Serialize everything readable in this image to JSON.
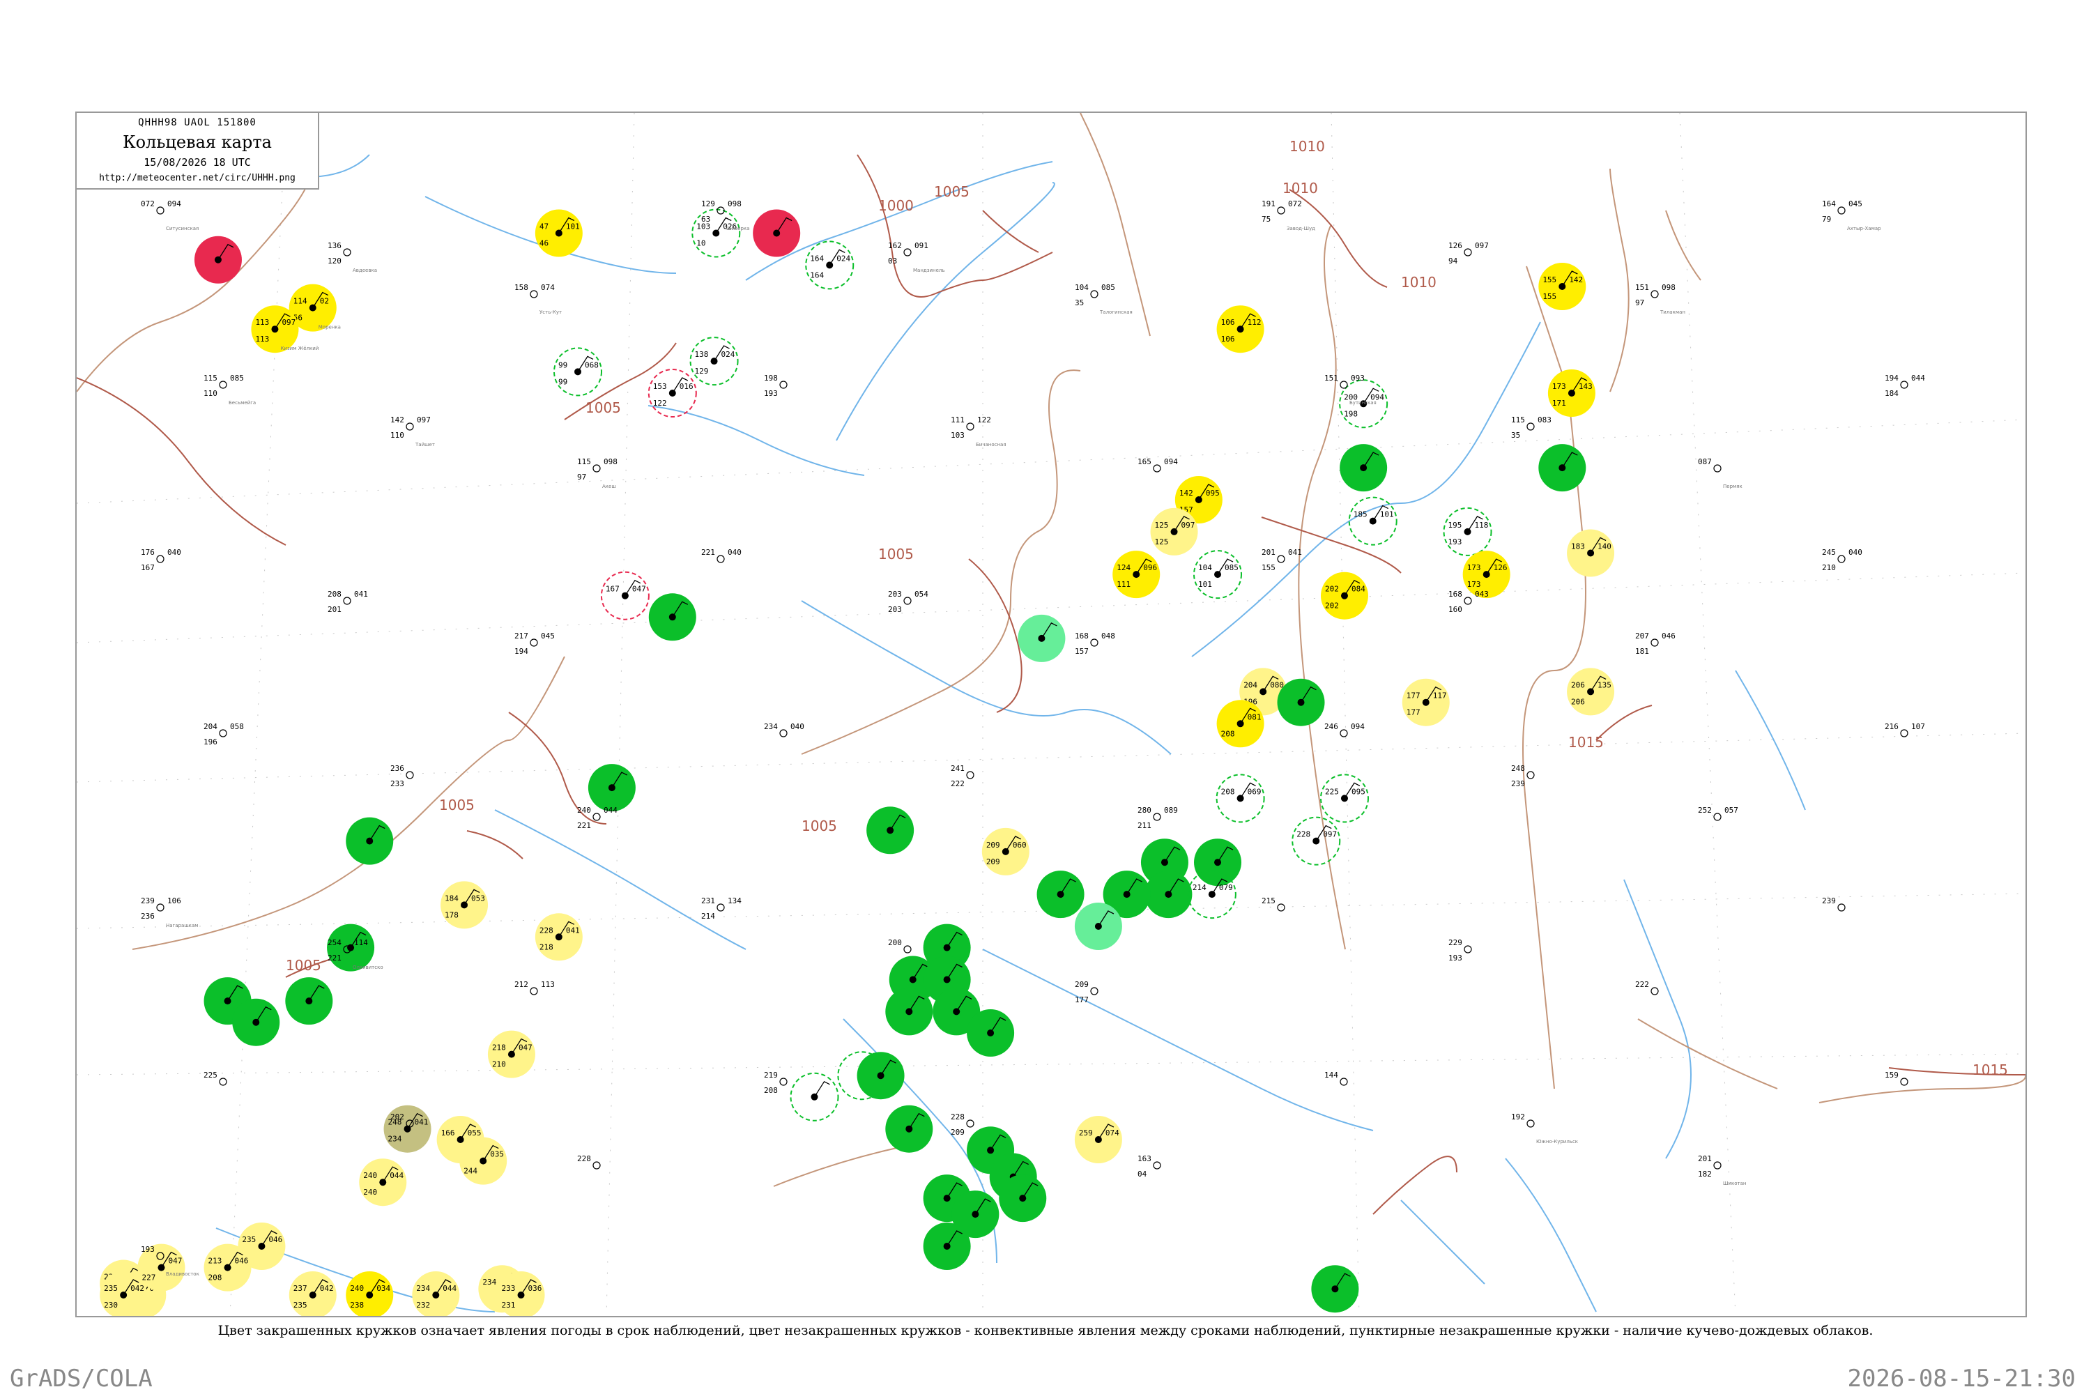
{
  "title": {
    "code": "QHHH98  UAOL  151800",
    "main": "Кольцевая карта",
    "date": "15/08/2026 18 UTC",
    "url": "http://meteocenter.net/circ/UHHH.png"
  },
  "caption": "Цвет закрашенных кружков означает явления погоды в срок наблюдений, цвет незакрашенных кружков - конвективные явления между сроками наблюдений, пунктирные незакрашенные кружки - наличие кучево-дождевых облаков.",
  "footer": {
    "left": "GrADS/COLA",
    "right": "2026-08-15-21:30"
  },
  "colors": {
    "rain": "#0bbf2a",
    "drizzle": "#66ee99",
    "haze": "#ffee00",
    "light_haze": "#fff48a",
    "thunder": "#e8294f",
    "dust": "#c4c081",
    "isobar": "#b05a4a",
    "river": "#58a8e6",
    "border": "#c4967a"
  },
  "isobars": [
    {
      "label": "1000"
    },
    {
      "label": "1005"
    },
    {
      "label": "1005"
    },
    {
      "label": "1005"
    },
    {
      "label": "1005"
    },
    {
      "label": "1005"
    },
    {
      "label": "1010"
    },
    {
      "label": "1010"
    },
    {
      "label": "1010"
    },
    {
      "label": "1010"
    },
    {
      "label": "1015"
    },
    {
      "label": "1015"
    },
    {
      "label": "1005"
    }
  ],
  "stations": [
    {
      "type": "thunder",
      "name": "",
      "t": "",
      "p": "",
      "d": "",
      "lat": 0.925,
      "lon": 0.06
    },
    {
      "type": "haze",
      "name": "Моренка",
      "t": "114",
      "p": "56",
      "d": "02",
      "lat": 0.88,
      "lon": 0.11
    },
    {
      "type": "haze",
      "name": "Кизим Жёлкий",
      "t": "113",
      "p": "113",
      "d": "097",
      "lat": 0.86,
      "lon": 0.09
    },
    {
      "type": "haze",
      "name": "",
      "t": "47",
      "p": "46",
      "d": "101",
      "lat": 0.95,
      "lon": 0.24
    },
    {
      "type": "thunder",
      "name": "",
      "t": "",
      "p": "",
      "d": "",
      "lat": 0.95,
      "lon": 0.355
    },
    {
      "type": "ring_red",
      "name": "",
      "t": "153",
      "p": "122",
      "d": "016",
      "lat": 0.8,
      "lon": 0.3
    },
    {
      "type": "ring_green",
      "name": "",
      "t": "103",
      "p": "10",
      "d": "026",
      "lat": 0.95,
      "lon": 0.323
    },
    {
      "type": "ring_green",
      "name": "",
      "t": "164",
      "p": "164",
      "d": "024",
      "lat": 0.92,
      "lon": 0.383
    },
    {
      "type": "ring_green",
      "name": "",
      "t": "99",
      "p": "99",
      "d": "068",
      "lat": 0.82,
      "lon": 0.25
    },
    {
      "type": "ring_green",
      "name": "",
      "t": "138",
      "p": "129",
      "d": "024",
      "lat": 0.83,
      "lon": 0.322
    },
    {
      "type": "ring_red",
      "name": "",
      "t": "167",
      "p": "",
      "d": "047",
      "lat": 0.61,
      "lon": 0.275
    },
    {
      "type": "rain",
      "name": "",
      "t": "",
      "p": "",
      "d": "",
      "lat": 0.59,
      "lon": 0.3
    },
    {
      "type": "drizzle",
      "name": "",
      "t": "",
      "p": "",
      "d": "",
      "lat": 0.57,
      "lon": 0.495
    },
    {
      "type": "haze",
      "name": "",
      "t": "106",
      "p": "106",
      "d": "112",
      "lat": 0.86,
      "lon": 0.6
    },
    {
      "type": "haze",
      "name": "",
      "t": "142",
      "p": "157",
      "d": "095",
      "lat": 0.7,
      "lon": 0.578
    },
    {
      "type": "light_haze",
      "name": "",
      "t": "125",
      "p": "125",
      "d": "097",
      "lat": 0.67,
      "lon": 0.565
    },
    {
      "type": "haze",
      "name": "",
      "t": "124",
      "p": "111",
      "d": "096",
      "lat": 0.63,
      "lon": 0.545
    },
    {
      "type": "ring_green",
      "name": "",
      "t": "104",
      "p": "101",
      "d": "085",
      "lat": 0.63,
      "lon": 0.588
    },
    {
      "type": "haze",
      "name": "",
      "t": "155",
      "p": "155",
      "d": "142",
      "lat": 0.9,
      "lon": 0.77
    },
    {
      "type": "haze",
      "name": "",
      "t": "173",
      "p": "171",
      "d": "143",
      "lat": 0.8,
      "lon": 0.775
    },
    {
      "type": "rain",
      "name": "",
      "t": "",
      "p": "",
      "d": "",
      "lat": 0.73,
      "lon": 0.77
    },
    {
      "type": "ring_green",
      "name": "",
      "t": "195",
      "p": "193",
      "d": "118",
      "lat": 0.67,
      "lon": 0.72
    },
    {
      "type": "haze",
      "name": "",
      "t": "173",
      "p": "173",
      "d": "126",
      "lat": 0.63,
      "lon": 0.73
    },
    {
      "type": "light_haze",
      "name": "",
      "t": "183",
      "p": "",
      "d": "140",
      "lat": 0.65,
      "lon": 0.785
    },
    {
      "type": "light_haze",
      "name": "",
      "t": "206",
      "p": "206",
      "d": "135",
      "lat": 0.52,
      "lon": 0.785
    },
    {
      "type": "ring_green",
      "name": "",
      "t": "200",
      "p": "198",
      "d": "094",
      "lat": 0.79,
      "lon": 0.665
    },
    {
      "type": "rain",
      "name": "",
      "t": "",
      "p": "",
      "d": "",
      "lat": 0.73,
      "lon": 0.665
    },
    {
      "type": "ring_green",
      "name": "",
      "t": "185",
      "p": "",
      "d": "101",
      "lat": 0.68,
      "lon": 0.67
    },
    {
      "type": "haze",
      "name": "",
      "t": "202",
      "p": "202",
      "d": "084",
      "lat": 0.61,
      "lon": 0.655
    },
    {
      "type": "light_haze",
      "name": "",
      "t": "177",
      "p": "177",
      "d": "117",
      "lat": 0.51,
      "lon": 0.698
    },
    {
      "type": "light_haze",
      "name": "",
      "t": "204",
      "p": "196",
      "d": "080",
      "lat": 0.52,
      "lon": 0.612
    },
    {
      "type": "rain",
      "name": "",
      "t": "",
      "p": "",
      "d": "",
      "lat": 0.51,
      "lon": 0.632
    },
    {
      "type": "haze",
      "name": "",
      "t": "",
      "p": "208",
      "d": "081",
      "lat": 0.49,
      "lon": 0.6
    },
    {
      "type": "ring_green",
      "name": "",
      "t": "225",
      "p": "",
      "d": "095",
      "lat": 0.42,
      "lon": 0.655
    },
    {
      "type": "ring_green",
      "name": "",
      "t": "228",
      "p": "",
      "d": "097",
      "lat": 0.38,
      "lon": 0.64
    },
    {
      "type": "rain",
      "name": "",
      "t": "",
      "p": "",
      "d": "",
      "lat": 0.36,
      "lon": 0.56
    },
    {
      "type": "rain",
      "name": "",
      "t": "",
      "p": "",
      "d": "",
      "lat": 0.36,
      "lon": 0.588
    },
    {
      "type": "rain",
      "name": "",
      "t": "",
      "p": "",
      "d": "",
      "lat": 0.33,
      "lon": 0.562
    },
    {
      "type": "rain",
      "name": "",
      "t": "",
      "p": "",
      "d": "",
      "lat": 0.33,
      "lon": 0.54
    },
    {
      "type": "ring_green",
      "name": "",
      "t": "214",
      "p": "",
      "d": "079",
      "lat": 0.33,
      "lon": 0.585
    },
    {
      "type": "ring_green",
      "name": "",
      "t": "208",
      "p": "",
      "d": "069",
      "lat": 0.42,
      "lon": 0.6
    },
    {
      "type": "light_haze",
      "name": "",
      "t": "209",
      "p": "209",
      "d": "060",
      "lat": 0.37,
      "lon": 0.476
    },
    {
      "type": "rain",
      "name": "",
      "t": "",
      "p": "",
      "d": "",
      "lat": 0.33,
      "lon": 0.505
    },
    {
      "type": "drizzle",
      "name": "",
      "t": "",
      "p": "",
      "d": "",
      "lat": 0.3,
      "lon": 0.525
    },
    {
      "type": "rain",
      "name": "",
      "t": "",
      "p": "",
      "d": "",
      "lat": 0.43,
      "lon": 0.268
    },
    {
      "type": "rain",
      "name": "",
      "t": "",
      "p": "",
      "d": "",
      "lat": 0.39,
      "lon": 0.415
    },
    {
      "type": "rain",
      "name": "",
      "t": "",
      "p": "",
      "d": "",
      "lat": 0.28,
      "lon": 0.445
    },
    {
      "type": "rain",
      "name": "",
      "t": "",
      "p": "",
      "d": "",
      "lat": 0.25,
      "lon": 0.427
    },
    {
      "type": "rain",
      "name": "",
      "t": "",
      "p": "",
      "d": "",
      "lat": 0.25,
      "lon": 0.445
    },
    {
      "type": "rain",
      "name": "",
      "t": "",
      "p": "",
      "d": "",
      "lat": 0.22,
      "lon": 0.425
    },
    {
      "type": "rain",
      "name": "",
      "t": "",
      "p": "",
      "d": "",
      "lat": 0.22,
      "lon": 0.45
    },
    {
      "type": "rain",
      "name": "",
      "t": "",
      "p": "",
      "d": "",
      "lat": 0.2,
      "lon": 0.468
    },
    {
      "type": "ring_green",
      "name": "",
      "t": "",
      "p": "",
      "d": "",
      "lat": 0.16,
      "lon": 0.4
    },
    {
      "type": "rain",
      "name": "",
      "t": "",
      "p": "",
      "d": "",
      "lat": 0.16,
      "lon": 0.41
    },
    {
      "type": "rain",
      "name": "",
      "t": "",
      "p": "",
      "d": "",
      "lat": 0.11,
      "lon": 0.425
    },
    {
      "type": "rain",
      "name": "",
      "t": "",
      "p": "",
      "d": "",
      "lat": 0.09,
      "lon": 0.468
    },
    {
      "type": "rain",
      "name": "",
      "t": "",
      "p": "",
      "d": "",
      "lat": 0.065,
      "lon": 0.48
    },
    {
      "type": "rain",
      "name": "",
      "t": "",
      "p": "",
      "d": "",
      "lat": 0.045,
      "lon": 0.485
    },
    {
      "type": "rain",
      "name": "",
      "t": "",
      "p": "",
      "d": "",
      "lat": 0.045,
      "lon": 0.445
    },
    {
      "type": "rain",
      "name": "",
      "t": "",
      "p": "",
      "d": "",
      "lat": 0.03,
      "lon": 0.46
    },
    {
      "type": "rain",
      "name": "",
      "t": "",
      "p": "",
      "d": "",
      "lat": 0.0,
      "lon": 0.445
    },
    {
      "type": "light_haze",
      "name": "",
      "t": "259",
      "p": "",
      "d": "074",
      "lat": 0.1,
      "lon": 0.525
    },
    {
      "type": "rain",
      "name": "",
      "t": "",
      "p": "",
      "d": "",
      "lat": -0.04,
      "lon": 0.65
    },
    {
      "type": "rain",
      "name": "",
      "t": "",
      "p": "",
      "d": "",
      "lat": 0.38,
      "lon": 0.14
    },
    {
      "type": "rain",
      "name": "",
      "t": "",
      "p": "",
      "d": "",
      "lat": 0.28,
      "lon": 0.13
    },
    {
      "type": "rain",
      "name": "",
      "t": "",
      "p": "",
      "d": "",
      "lat": 0.23,
      "lon": 0.065
    },
    {
      "type": "rain",
      "name": "",
      "t": "",
      "p": "",
      "d": "",
      "lat": 0.21,
      "lon": 0.08
    },
    {
      "type": "rain",
      "name": "",
      "t": "",
      "p": "",
      "d": "",
      "lat": 0.23,
      "lon": 0.108
    },
    {
      "type": "light_haze",
      "name": "",
      "t": "184",
      "p": "178",
      "d": "053",
      "lat": 0.32,
      "lon": 0.19
    },
    {
      "type": "light_haze",
      "name": "",
      "t": "228",
      "p": "218",
      "d": "041",
      "lat": 0.29,
      "lon": 0.24
    },
    {
      "type": "light_haze",
      "name": "",
      "t": "218",
      "p": "210",
      "d": "047",
      "lat": 0.18,
      "lon": 0.215
    },
    {
      "type": "dust",
      "name": "",
      "t": "248",
      "p": "234",
      "d": "041",
      "lat": 0.11,
      "lon": 0.16
    },
    {
      "type": "light_haze",
      "name": "",
      "t": "166",
      "p": "",
      "d": "055",
      "lat": 0.1,
      "lon": 0.188
    },
    {
      "type": "light_haze",
      "name": "",
      "t": "",
      "p": "244",
      "d": "035",
      "lat": 0.08,
      "lon": 0.2
    },
    {
      "type": "light_haze",
      "name": "",
      "t": "240",
      "p": "240",
      "d": "044",
      "lat": 0.06,
      "lon": 0.147
    },
    {
      "type": "light_haze",
      "name": "",
      "t": "235",
      "p": "",
      "d": "046",
      "lat": 0.0,
      "lon": 0.083
    },
    {
      "type": "light_haze",
      "name": "",
      "t": "213",
      "p": "208",
      "d": "046",
      "lat": -0.02,
      "lon": 0.065
    },
    {
      "type": "light_haze",
      "name": "",
      "t": "233",
      "p": "",
      "d": "044",
      "lat": -0.035,
      "lon": 0.01
    },
    {
      "type": "light_haze",
      "name": "",
      "t": "",
      "p": "230",
      "d": "045",
      "lat": -0.06,
      "lon": 0.02
    },
    {
      "type": "light_haze",
      "name": "",
      "t": "",
      "p": "227",
      "d": "047",
      "lat": -0.02,
      "lon": 0.03
    },
    {
      "type": "light_haze",
      "name": "",
      "t": "235",
      "p": "230",
      "d": "042",
      "lat": -0.09,
      "lon": 0.01
    },
    {
      "type": "light_haze",
      "name": "",
      "t": "234",
      "p": "232",
      "d": "044",
      "lat": -0.075,
      "lon": 0.175
    },
    {
      "type": "light_haze",
      "name": "",
      "t": "234",
      "p": "",
      "d": "040",
      "lat": -0.04,
      "lon": 0.21
    },
    {
      "type": "light_haze",
      "name": "",
      "t": "233",
      "p": "231",
      "d": "036",
      "lat": -0.09,
      "lon": 0.22
    },
    {
      "type": "light_haze",
      "name": "",
      "t": "237",
      "p": "235",
      "d": "042",
      "lat": -0.12,
      "lon": 0.11
    },
    {
      "type": "haze",
      "name": "",
      "t": "240",
      "p": "238",
      "d": "034",
      "lat": -0.11,
      "lon": 0.14
    },
    {
      "type": "ring_green",
      "name": "",
      "t": "",
      "p": "",
      "d": "",
      "lat": 0.14,
      "lon": 0.375
    }
  ],
  "labels": [
    {
      "t": "072",
      "p": "",
      "d": "094",
      "name": "Ситусинская"
    },
    {
      "t": "136",
      "p": "120",
      "d": "",
      "name": "Авдеевка"
    },
    {
      "t": "158",
      "p": "",
      "d": "074",
      "name": "Усть-Кут"
    },
    {
      "t": "129",
      "p": "63",
      "d": "098",
      "name": "Шиверка"
    },
    {
      "t": "162",
      "p": "03",
      "d": "091",
      "name": "Мандзинель"
    },
    {
      "t": "104",
      "p": "35",
      "d": "085",
      "name": "Талогинская"
    },
    {
      "t": "191",
      "p": "75",
      "d": "072",
      "name": "Завод-Шуд"
    },
    {
      "t": "126",
      "p": "94",
      "d": "097",
      "name": ""
    },
    {
      "t": "151",
      "p": "97",
      "d": "098",
      "name": "Тилакман"
    },
    {
      "t": "164",
      "p": "79",
      "d": "045",
      "name": "Ахтыр-Хамар"
    },
    {
      "t": "115",
      "p": "110",
      "d": "085",
      "name": "Бесьмейга"
    },
    {
      "t": "142",
      "p": "110",
      "d": "097",
      "name": "Тайшет"
    },
    {
      "t": "115",
      "p": "97",
      "d": "098",
      "name": "Акеш"
    },
    {
      "t": "198",
      "p": "193",
      "d": "",
      "name": ""
    },
    {
      "t": "111",
      "p": "103",
      "d": "122",
      "name": "Бичаносная"
    },
    {
      "t": "165",
      "p": "",
      "d": "094",
      "name": ""
    },
    {
      "t": "151",
      "p": "",
      "d": "093",
      "name": "Бутинская"
    },
    {
      "t": "115",
      "p": "35",
      "d": "083",
      "name": ""
    },
    {
      "t": "087",
      "p": "",
      "d": "",
      "name": "Пермяк"
    },
    {
      "t": "194",
      "p": "184",
      "d": "044",
      "name": ""
    },
    {
      "t": "176",
      "p": "167",
      "d": "040",
      "name": ""
    },
    {
      "t": "208",
      "p": "201",
      "d": "041",
      "name": ""
    },
    {
      "t": "217",
      "p": "194",
      "d": "045",
      "name": ""
    },
    {
      "t": "221",
      "p": "",
      "d": "040",
      "name": ""
    },
    {
      "t": "203",
      "p": "203",
      "d": "054",
      "name": ""
    },
    {
      "t": "168",
      "p": "157",
      "d": "048",
      "name": ""
    },
    {
      "t": "201",
      "p": "155",
      "d": "041",
      "name": ""
    },
    {
      "t": "168",
      "p": "160",
      "d": "043",
      "name": ""
    },
    {
      "t": "207",
      "p": "181",
      "d": "046",
      "name": ""
    },
    {
      "t": "245",
      "p": "210",
      "d": "040",
      "name": ""
    },
    {
      "t": "204",
      "p": "196",
      "d": "058",
      "name": ""
    },
    {
      "t": "236",
      "p": "233",
      "d": "",
      "name": ""
    },
    {
      "t": "240",
      "p": "221",
      "d": "044",
      "name": ""
    },
    {
      "t": "234",
      "p": "",
      "d": "040",
      "name": ""
    },
    {
      "t": "241",
      "p": "222",
      "d": "",
      "name": ""
    },
    {
      "t": "280",
      "p": "211",
      "d": "089",
      "name": ""
    },
    {
      "t": "246",
      "p": "",
      "d": "094",
      "name": ""
    },
    {
      "t": "248",
      "p": "239",
      "d": "",
      "name": ""
    },
    {
      "t": "252",
      "p": "",
      "d": "057",
      "name": ""
    },
    {
      "t": "216",
      "p": "",
      "d": "107",
      "name": ""
    },
    {
      "t": "239",
      "p": "236",
      "d": "106",
      "name": "Нагарашкам"
    },
    {
      "t": "254",
      "p": "221",
      "d": "114",
      "name": "Олаявитско"
    },
    {
      "t": "212",
      "p": "",
      "d": "113",
      "name": ""
    },
    {
      "t": "231",
      "p": "214",
      "d": "134",
      "name": ""
    },
    {
      "t": "200",
      "p": "",
      "d": "",
      "name": ""
    },
    {
      "t": "209",
      "p": "177",
      "d": "",
      "name": ""
    },
    {
      "t": "215",
      "p": "",
      "d": "",
      "name": ""
    },
    {
      "t": "229",
      "p": "193",
      "d": "",
      "name": ""
    },
    {
      "t": "222",
      "p": "",
      "d": "",
      "name": ""
    },
    {
      "t": "239",
      "p": "",
      "d": "",
      "name": ""
    },
    {
      "t": "225",
      "p": "",
      "d": "",
      "name": ""
    },
    {
      "t": "202",
      "p": "",
      "d": "",
      "name": ""
    },
    {
      "t": "228",
      "p": "",
      "d": "",
      "name": ""
    },
    {
      "t": "219",
      "p": "208",
      "d": "",
      "name": ""
    },
    {
      "t": "228",
      "p": "209",
      "d": "",
      "name": ""
    },
    {
      "t": "163",
      "p": "04",
      "d": "",
      "name": ""
    },
    {
      "t": "144",
      "p": "",
      "d": "",
      "name": ""
    },
    {
      "t": "192",
      "p": "",
      "d": "",
      "name": "Южно-Курильск"
    },
    {
      "t": "201",
      "p": "182",
      "d": "",
      "name": "Шикотан"
    },
    {
      "t": "159",
      "p": "",
      "d": "",
      "name": ""
    },
    {
      "t": "193",
      "p": "",
      "d": "",
      "name": "Владивосток"
    }
  ]
}
